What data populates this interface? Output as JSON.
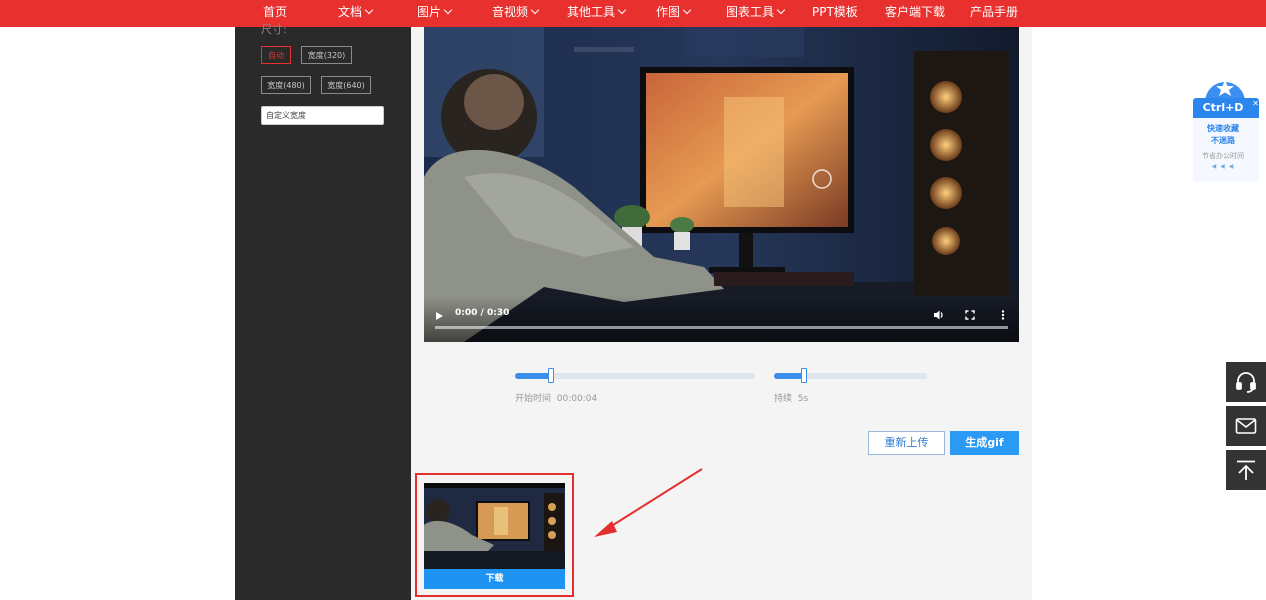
{
  "nav": {
    "items": [
      {
        "label": "首页",
        "dropdown": false
      },
      {
        "label": "文档",
        "dropdown": true
      },
      {
        "label": "图片",
        "dropdown": true
      },
      {
        "label": "音视频",
        "dropdown": true
      },
      {
        "label": "其他工具",
        "dropdown": true
      },
      {
        "label": "作图",
        "dropdown": true
      },
      {
        "label": "图表工具",
        "dropdown": true
      },
      {
        "label": "PPT模板",
        "dropdown": false
      },
      {
        "label": "客户端下载",
        "dropdown": false
      },
      {
        "label": "产品手册",
        "dropdown": false
      }
    ]
  },
  "sidebar": {
    "size_label": "尺寸:",
    "options": [
      {
        "label": "自动",
        "active": true
      },
      {
        "label": "宽度(320)",
        "active": false
      },
      {
        "label": "宽度(480)",
        "active": false
      },
      {
        "label": "宽度(640)",
        "active": false
      }
    ],
    "custom_width_placeholder": "自定义宽度"
  },
  "video": {
    "time": "0:00 / 0:30",
    "progress": 0
  },
  "start_slider": {
    "label": "开始时间",
    "value": "00:00:04",
    "fraction": 0.148
  },
  "duration_slider": {
    "label": "持续",
    "value": "5s",
    "fraction": 0.196
  },
  "buttons": {
    "reupload": "重新上传",
    "generate": "生成gif"
  },
  "result": {
    "download_label": "下载"
  },
  "favorite": {
    "shortcut": "Ctrl+D",
    "line1": "快速收藏",
    "line2": "不迷路",
    "tip": "节省办公时间",
    "dots": "◀ ◀ ◀"
  },
  "colors": {
    "nav_bg": "#e8312f",
    "accent_blue": "#2a9af4",
    "highlight_red": "#e3302f",
    "panel_dark": "#2a2a2a"
  },
  "icons": {
    "play": "play-icon",
    "volume": "volume-icon",
    "fullscreen": "fullscreen-icon",
    "more": "more-vertical-icon",
    "service": "customer-service-icon",
    "mail": "mail-icon",
    "top": "back-to-top-icon"
  }
}
